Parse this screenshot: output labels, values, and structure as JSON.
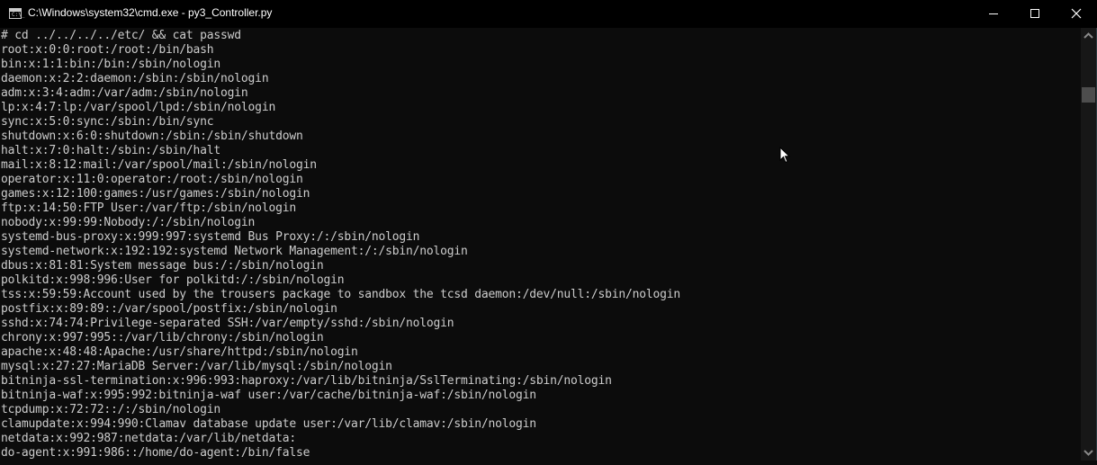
{
  "window": {
    "title": "C:\\Windows\\system32\\cmd.exe - py3_Controller.py",
    "app_icon": "cmd-icon",
    "app_icon_text": "C:\\_",
    "controls": {
      "minimize": "minimize-icon",
      "maximize": "maximize-icon",
      "close": "close-icon"
    }
  },
  "console": {
    "lines": [
      "# cd ../../../../etc/ && cat passwd",
      "root:x:0:0:root:/root:/bin/bash",
      "bin:x:1:1:bin:/bin:/sbin/nologin",
      "daemon:x:2:2:daemon:/sbin:/sbin/nologin",
      "adm:x:3:4:adm:/var/adm:/sbin/nologin",
      "lp:x:4:7:lp:/var/spool/lpd:/sbin/nologin",
      "sync:x:5:0:sync:/sbin:/bin/sync",
      "shutdown:x:6:0:shutdown:/sbin:/sbin/shutdown",
      "halt:x:7:0:halt:/sbin:/sbin/halt",
      "mail:x:8:12:mail:/var/spool/mail:/sbin/nologin",
      "operator:x:11:0:operator:/root:/sbin/nologin",
      "games:x:12:100:games:/usr/games:/sbin/nologin",
      "ftp:x:14:50:FTP User:/var/ftp:/sbin/nologin",
      "nobody:x:99:99:Nobody:/:/sbin/nologin",
      "systemd-bus-proxy:x:999:997:systemd Bus Proxy:/:/sbin/nologin",
      "systemd-network:x:192:192:systemd Network Management:/:/sbin/nologin",
      "dbus:x:81:81:System message bus:/:/sbin/nologin",
      "polkitd:x:998:996:User for polkitd:/:/sbin/nologin",
      "tss:x:59:59:Account used by the trousers package to sandbox the tcsd daemon:/dev/null:/sbin/nologin",
      "postfix:x:89:89::/var/spool/postfix:/sbin/nologin",
      "sshd:x:74:74:Privilege-separated SSH:/var/empty/sshd:/sbin/nologin",
      "chrony:x:997:995::/var/lib/chrony:/sbin/nologin",
      "apache:x:48:48:Apache:/usr/share/httpd:/sbin/nologin",
      "mysql:x:27:27:MariaDB Server:/var/lib/mysql:/sbin/nologin",
      "bitninja-ssl-termination:x:996:993:haproxy:/var/lib/bitninja/SslTerminating:/sbin/nologin",
      "bitninja-waf:x:995:992:bitninja-waf user:/var/cache/bitninja-waf:/sbin/nologin",
      "tcpdump:x:72:72::/:/sbin/nologin",
      "clamupdate:x:994:990:Clamav database update user:/var/lib/clamav:/sbin/nologin",
      "netdata:x:992:987:netdata:/var/lib/netdata:",
      "do-agent:x:991:986::/home/do-agent:/bin/false"
    ]
  },
  "scrollbar": {
    "up_icon": "chevron-up-icon",
    "down_icon": "chevron-down-icon",
    "position_fraction": 0.14
  },
  "colors": {
    "titlebar_bg": "#000000",
    "console_bg": "#0c0c0c",
    "console_fg": "#cccccc",
    "scrollbar_bg": "#171717",
    "scroll_thumb": "#4d4d4d"
  }
}
